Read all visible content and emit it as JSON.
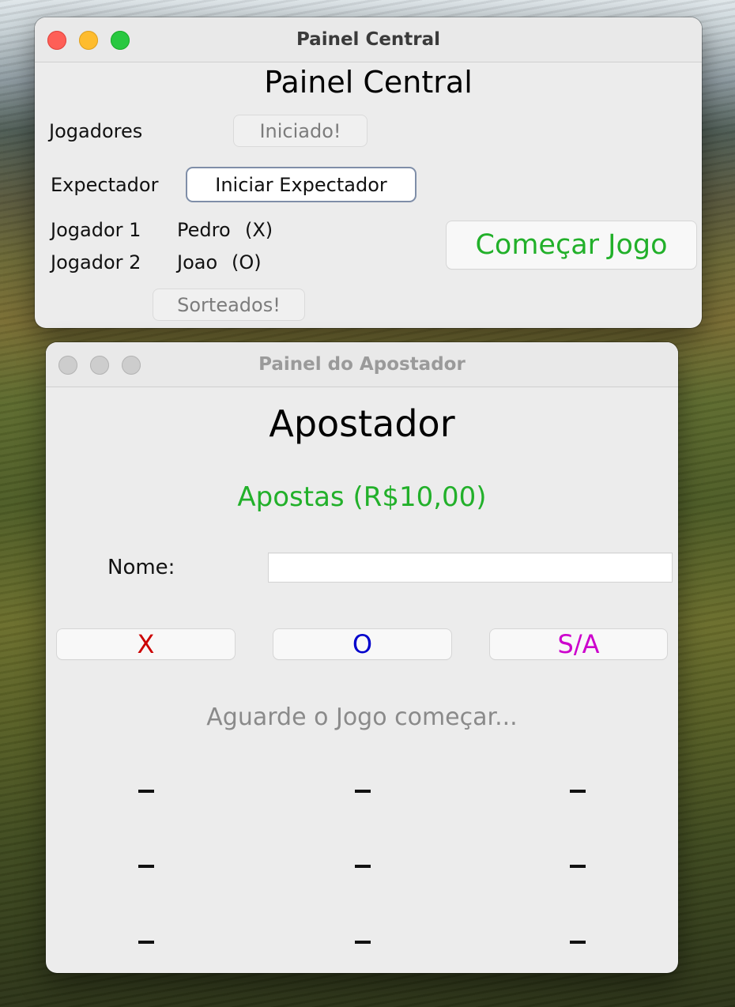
{
  "central_window": {
    "title": "Painel Central",
    "heading": "Painel Central",
    "players_label": "Jogadores",
    "players_button": "Iniciado!",
    "spectator_label": "Expectador",
    "spectator_button": "Iniciar Expectador",
    "player1_label": "Jogador 1",
    "player1_name": "Pedro",
    "player1_symbol": "(X)",
    "player2_label": "Jogador 2",
    "player2_name": "Joao",
    "player2_symbol": "(O)",
    "draw_button": "Sorteados!",
    "start_button": "Começar Jogo",
    "start_button_color": "#22b02a"
  },
  "bettor_window": {
    "title": "Painel do Apostador",
    "heading": "Apostador",
    "bets_title": "Apostas (R$10,00)",
    "bets_title_color": "#22b02a",
    "name_label": "Nome:",
    "name_value": "",
    "options": [
      {
        "label": "X",
        "color": "#cc0000"
      },
      {
        "label": "O",
        "color": "#0000cc"
      },
      {
        "label": "S/A",
        "color": "#cc00cc"
      }
    ],
    "status": "Aguarde o Jogo começar...",
    "board": [
      [
        "–",
        "–",
        "–"
      ],
      [
        "–",
        "–",
        "–"
      ],
      [
        "–",
        "–",
        "–"
      ]
    ]
  }
}
